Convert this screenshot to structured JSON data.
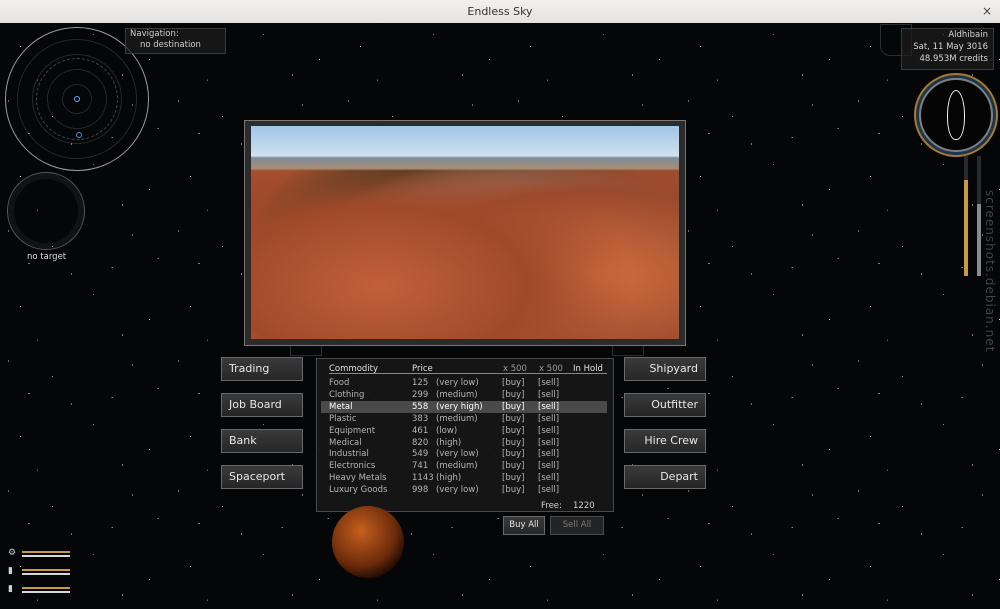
{
  "window": {
    "title": "Endless Sky",
    "close_glyph": "×"
  },
  "navigation": {
    "label": "Navigation:",
    "destination": "no destination"
  },
  "target": {
    "label": "no target"
  },
  "status": {
    "system": "Aldhibain",
    "date": "Sat, 11 May 3016",
    "credits": "48.953M credits"
  },
  "menu": {
    "trading": "Trading",
    "job_board": "Job Board",
    "bank": "Bank",
    "spaceport": "Spaceport",
    "shipyard": "Shipyard",
    "outfitter": "Outfitter",
    "hire_crew": "Hire Crew",
    "depart": "Depart"
  },
  "trade": {
    "headers": {
      "commodity": "Commodity",
      "price": "Price",
      "buy_qty": "x 500",
      "sell_qty": "x 500",
      "in_hold": "In Hold"
    },
    "rows": [
      {
        "name": "Food",
        "price": "125",
        "level": "(very low)",
        "buy": "[buy]",
        "sell": "[sell]"
      },
      {
        "name": "Clothing",
        "price": "299",
        "level": "(medium)",
        "buy": "[buy]",
        "sell": "[sell]"
      },
      {
        "name": "Metal",
        "price": "558",
        "level": "(very high)",
        "buy": "[buy]",
        "sell": "[sell]"
      },
      {
        "name": "Plastic",
        "price": "383",
        "level": "(medium)",
        "buy": "[buy]",
        "sell": "[sell]"
      },
      {
        "name": "Equipment",
        "price": "461",
        "level": "(low)",
        "buy": "[buy]",
        "sell": "[sell]"
      },
      {
        "name": "Medical",
        "price": "820",
        "level": "(high)",
        "buy": "[buy]",
        "sell": "[sell]"
      },
      {
        "name": "Industrial",
        "price": "549",
        "level": "(very low)",
        "buy": "[buy]",
        "sell": "[sell]"
      },
      {
        "name": "Electronics",
        "price": "741",
        "level": "(medium)",
        "buy": "[buy]",
        "sell": "[sell]"
      },
      {
        "name": "Heavy Metals",
        "price": "1143",
        "level": "(high)",
        "buy": "[buy]",
        "sell": "[sell]"
      },
      {
        "name": "Luxury Goods",
        "price": "998",
        "level": "(very low)",
        "buy": "[buy]",
        "sell": "[sell]"
      }
    ],
    "selected_row": 2,
    "free_label": "Free:",
    "free_value": "1220",
    "buy_all": "Buy All",
    "sell_all": "Sell All"
  },
  "watermark": "screenshots.debian.net",
  "icons": {
    "gear": "gear-icon",
    "ship_small": "ship-small-icon",
    "ship_large": "ship-outline-icon"
  },
  "colors": {
    "energy_bar": "#c99b3a",
    "heat_bar": "#b8b8b8",
    "shield_accent": "#2f6fa8"
  }
}
